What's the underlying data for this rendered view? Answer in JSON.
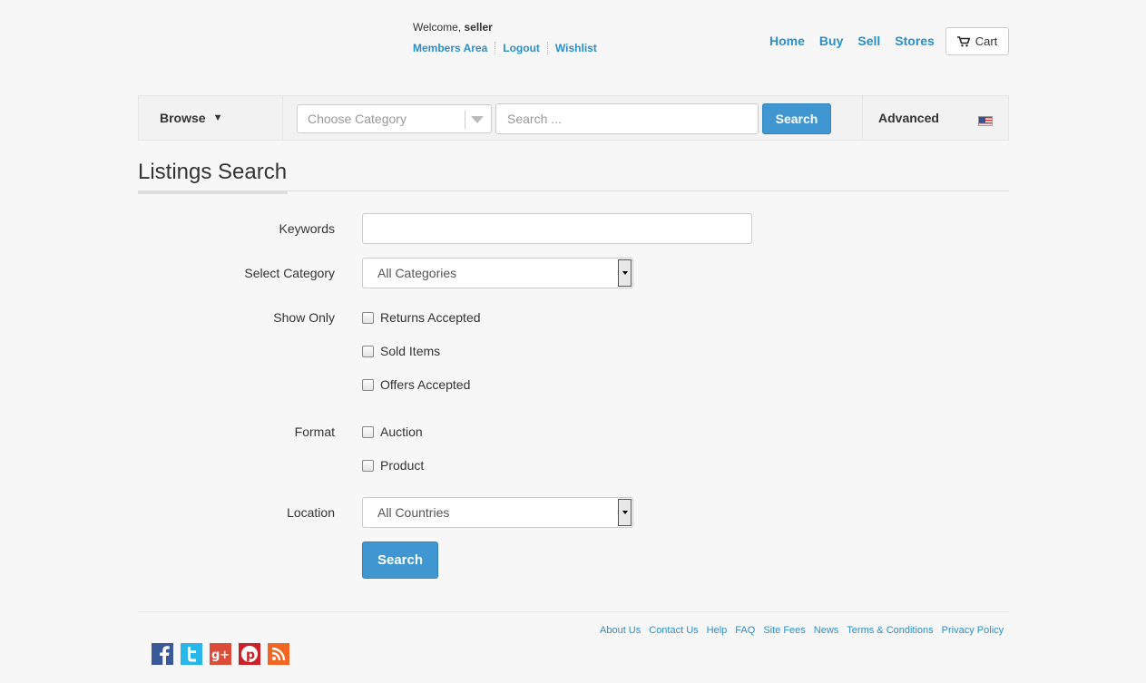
{
  "header": {
    "welcome_prefix": "Welcome,",
    "username": "seller",
    "member_links": [
      "Members Area",
      "Logout",
      "Wishlist"
    ],
    "nav": [
      "Home",
      "Buy",
      "Sell",
      "Stores"
    ],
    "cart_label": "Cart"
  },
  "searchbar": {
    "browse_label": "Browse",
    "category_placeholder": "Choose Category",
    "search_placeholder": "Search ...",
    "search_button": "Search",
    "advanced_label": "Advanced"
  },
  "page": {
    "title": "Listings Search"
  },
  "form": {
    "keywords_label": "Keywords",
    "keywords_value": "",
    "category_label": "Select Category",
    "category_value": "All Categories",
    "show_only_label": "Show Only",
    "show_only_options": [
      {
        "label": "Returns Accepted",
        "checked": false
      },
      {
        "label": "Sold Items",
        "checked": false
      },
      {
        "label": "Offers Accepted",
        "checked": false
      }
    ],
    "format_label": "Format",
    "format_options": [
      {
        "label": "Auction",
        "checked": false
      },
      {
        "label": "Product",
        "checked": false
      }
    ],
    "location_label": "Location",
    "location_value": "All Countries",
    "submit_label": "Search"
  },
  "footer": {
    "links": [
      "About Us",
      "Contact Us",
      "Help",
      "FAQ",
      "Site Fees",
      "News",
      "Terms & Conditions",
      "Privacy Policy"
    ],
    "social_icons": [
      "facebook-icon",
      "twitter-icon",
      "google-plus-icon",
      "pinterest-icon",
      "rss-icon"
    ]
  },
  "colors": {
    "accent": "#2a8fc9",
    "button": "#3f96d0",
    "background": "#f7f7f7"
  }
}
